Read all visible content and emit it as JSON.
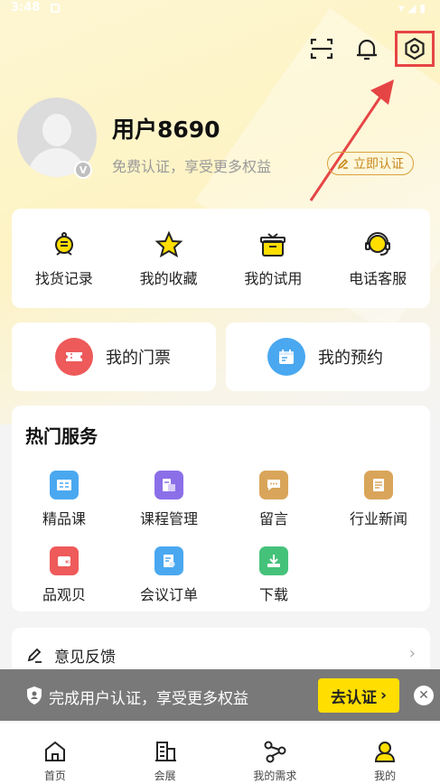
{
  "status_bar": {
    "time": "3:48"
  },
  "profile": {
    "username": "用户8690",
    "subtitle": "免费认证，享受更多权益",
    "verify_button": "立即认证",
    "badge": "V"
  },
  "quick_actions": [
    {
      "label": "找货记录",
      "icon": "search-record-icon"
    },
    {
      "label": "我的收藏",
      "icon": "star-icon"
    },
    {
      "label": "我的试用",
      "icon": "gift-box-icon"
    },
    {
      "label": "电话客服",
      "icon": "headset-icon"
    }
  ],
  "tickets": {
    "label": "我的门票",
    "icon": "ticket-icon"
  },
  "bookings": {
    "label": "我的预约",
    "icon": "calendar-icon"
  },
  "hot_services": {
    "title": "热门服务",
    "items": [
      {
        "label": "精品课",
        "icon": "course-icon",
        "color": "#4aa8f0"
      },
      {
        "label": "课程管理",
        "icon": "course-manage-icon",
        "color": "#8b6fe8"
      },
      {
        "label": "留言",
        "icon": "message-icon",
        "color": "#d9a55a"
      },
      {
        "label": "行业新闻",
        "icon": "news-icon",
        "color": "#d9a55a"
      },
      {
        "label": "品观贝",
        "icon": "wallet-icon",
        "color": "#ef5a5a"
      },
      {
        "label": "会议订单",
        "icon": "order-icon",
        "color": "#4aa8f0"
      },
      {
        "label": "下载",
        "icon": "download-icon",
        "color": "#45c27a"
      }
    ]
  },
  "feedback": {
    "label": "意见反馈"
  },
  "banner": {
    "text": "完成用户认证，享受更多权益",
    "button": "去认证"
  },
  "tabbar": [
    {
      "label": "首页",
      "icon": "home-icon"
    },
    {
      "label": "会展",
      "icon": "building-icon"
    },
    {
      "label": "我的需求",
      "icon": "share-nodes-icon"
    },
    {
      "label": "我的",
      "icon": "user-icon"
    }
  ],
  "colors": {
    "accent": "#ffde00",
    "highlight": "#e64545",
    "verify": "#c8891c"
  }
}
